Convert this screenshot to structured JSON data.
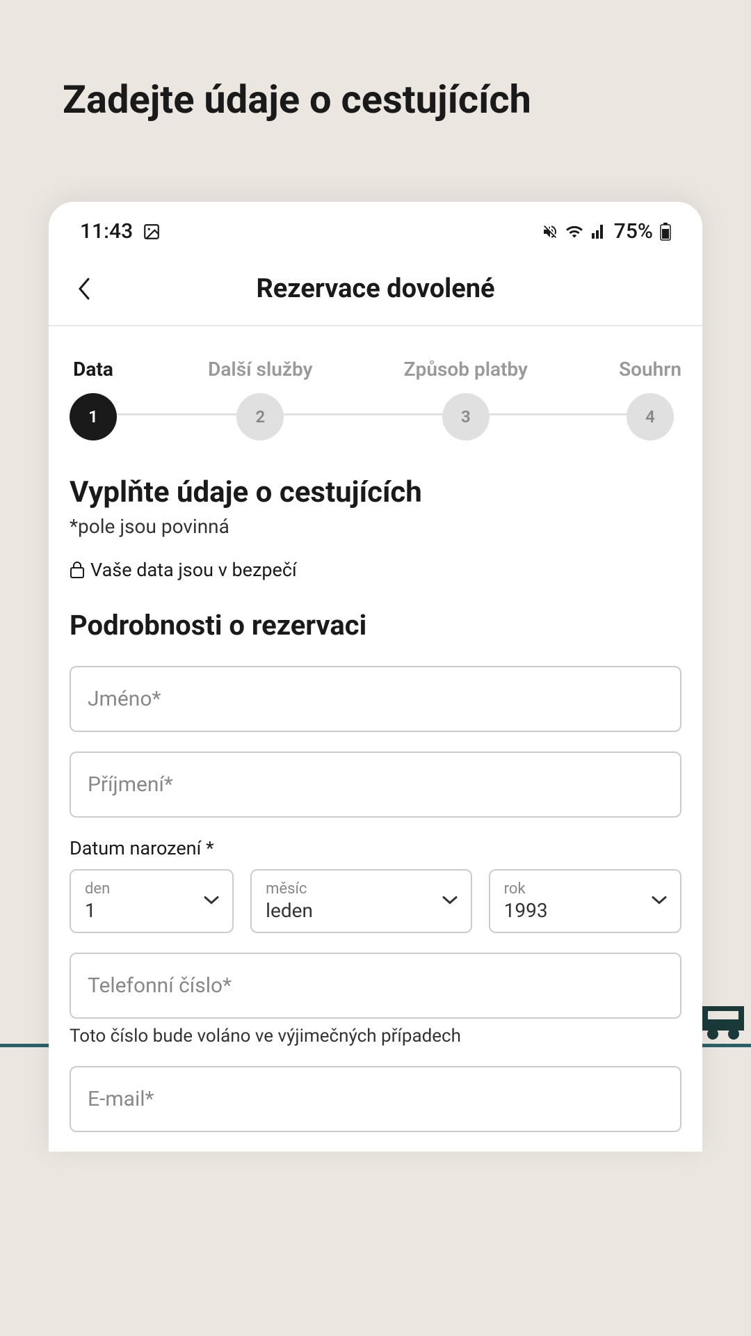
{
  "page": {
    "title": "Zadejte údaje o cestujících"
  },
  "statusBar": {
    "time": "11:43",
    "battery": "75%"
  },
  "header": {
    "title": "Rezervace dovolené"
  },
  "stepper": {
    "steps": [
      {
        "label": "Data",
        "number": "1",
        "active": true
      },
      {
        "label": "Další služby",
        "number": "2",
        "active": false
      },
      {
        "label": "Způsob platby",
        "number": "3",
        "active": false
      },
      {
        "label": "Souhrn",
        "number": "4",
        "active": false
      }
    ]
  },
  "form": {
    "sectionTitle": "Vyplňte údaje o cestujících",
    "requiredNote": "*pole jsou povinná",
    "securityNote": "Vaše data jsou v bezpečí",
    "subsectionTitle": "Podrobnosti o rezervaci",
    "firstName": {
      "placeholder": "Jméno*",
      "value": ""
    },
    "lastName": {
      "placeholder": "Příjmení*",
      "value": ""
    },
    "birthDate": {
      "label": "Datum narození *",
      "day": {
        "label": "den",
        "value": "1"
      },
      "month": {
        "label": "měsíc",
        "value": "leden"
      },
      "year": {
        "label": "rok",
        "value": "1993"
      }
    },
    "phone": {
      "placeholder": "Telefonní číslo*",
      "value": "",
      "helper": "Toto číslo bude voláno ve výjimečných případech"
    },
    "email": {
      "placeholder": "E-mail*",
      "value": ""
    }
  }
}
